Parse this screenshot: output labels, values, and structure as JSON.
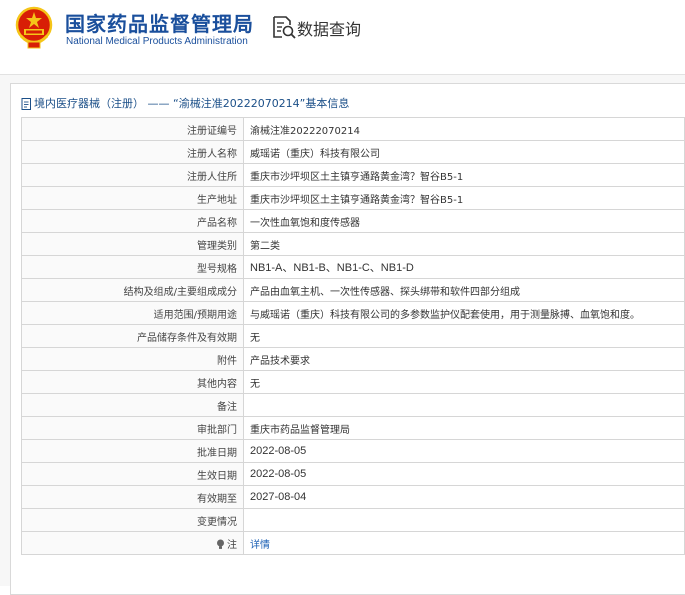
{
  "header": {
    "agency_cn": "国家药品监督管理局",
    "agency_en": "National Medical Products Administration",
    "data_query_label": "数据查询"
  },
  "breadcrumb": {
    "category": "境内医疗器械（注册）",
    "separator": "——",
    "title": "“渝械注准20222070214”基本信息"
  },
  "rows": [
    {
      "label": "注册证编号",
      "value": "渝械注准20222070214"
    },
    {
      "label": "注册人名称",
      "value": "威瑶诺（重庆）科技有限公司"
    },
    {
      "label": "注册人住所",
      "value": "重庆市沙坪坝区土主镇亨通路黄金湾？智谷B5-1"
    },
    {
      "label": "生产地址",
      "value": "重庆市沙坪坝区土主镇亨通路黄金湾？智谷B5-1"
    },
    {
      "label": "产品名称",
      "value": "一次性血氧饱和度传感器"
    },
    {
      "label": "管理类别",
      "value": "第二类"
    },
    {
      "label": "型号规格",
      "value": "NB1-A、NB1-B、NB1-C、NB1-D"
    },
    {
      "label": "结构及组成/主要组成成分",
      "value": "产品由血氧主机、一次性传感器、探头绑带和软件四部分组成"
    },
    {
      "label": "适用范围/预期用途",
      "value": "与威瑶诺（重庆）科技有限公司的多参数监护仪配套使用，用于测量脉搏、血氧饱和度。"
    },
    {
      "label": "产品储存条件及有效期",
      "value": "无"
    },
    {
      "label": "附件",
      "value": "产品技术要求"
    },
    {
      "label": "其他内容",
      "value": "无"
    },
    {
      "label": "备注",
      "value": ""
    },
    {
      "label": "审批部门",
      "value": "重庆市药品监督管理局"
    },
    {
      "label": "批准日期",
      "value": "2022-08-05"
    },
    {
      "label": "生效日期",
      "value": "2022-08-05"
    },
    {
      "label": "有效期至",
      "value": "2027-08-04"
    },
    {
      "label": "变更情况",
      "value": ""
    },
    {
      "label": "注",
      "value": "详情",
      "link": true,
      "icon": "bulb-icon"
    }
  ],
  "colors": {
    "brand_blue": "#1a4f9c",
    "link_blue": "#1a5fb4",
    "emblem_red": "#d81e06",
    "emblem_gold": "#f5c518"
  }
}
